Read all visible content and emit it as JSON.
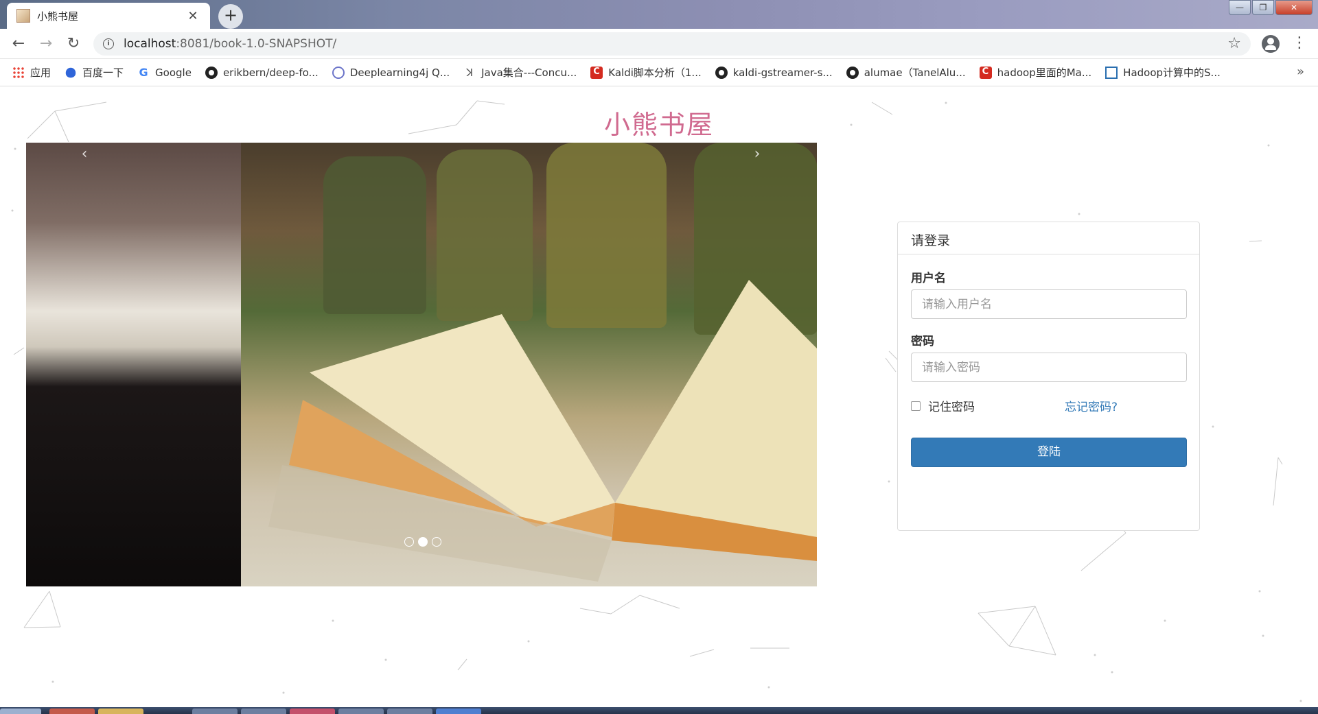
{
  "browser": {
    "tab_title": "小熊书屋",
    "new_tab": "+",
    "tab_close": "✕",
    "url_host": "localhost",
    "url_rest": ":8081/book-1.0-SNAPSHOT/",
    "bookmarks": [
      {
        "label": "应用",
        "icon": "apps-icon"
      },
      {
        "label": "百度一下",
        "icon": "baidu-paw-icon"
      },
      {
        "label": "Google",
        "icon": "google-icon"
      },
      {
        "label": "erikbern/deep-fo...",
        "icon": "github-icon"
      },
      {
        "label": "Deeplearning4j Q...",
        "icon": "atom-icon"
      },
      {
        "label": "Java集合---Concu...",
        "icon": "jianshu-icon"
      },
      {
        "label": "Kaldi脚本分析（1...",
        "icon": "csdn-icon"
      },
      {
        "label": "kaldi-gstreamer-s...",
        "icon": "github-icon"
      },
      {
        "label": "alumae（TanelAlu...",
        "icon": "github-icon"
      },
      {
        "label": "hadoop里面的Ma...",
        "icon": "csdn-icon"
      },
      {
        "label": "Hadoop计算中的S...",
        "icon": "chart-icon"
      }
    ],
    "bookmarks_more": "»"
  },
  "page": {
    "site_title": "小熊书屋",
    "carousel": {
      "prev": "‹",
      "next": "›",
      "active_index": 1,
      "slide_count": 3
    },
    "login": {
      "heading": "请登录",
      "username_label": "用户名",
      "username_placeholder": "请输入用户名",
      "password_label": "密码",
      "password_placeholder": "请输入密码",
      "remember_label": "记住密码",
      "forgot_label": "忘记密码?",
      "submit_label": "登陆"
    }
  },
  "colors": {
    "title_pink": "#d06a8f",
    "primary_blue": "#337ab7"
  }
}
